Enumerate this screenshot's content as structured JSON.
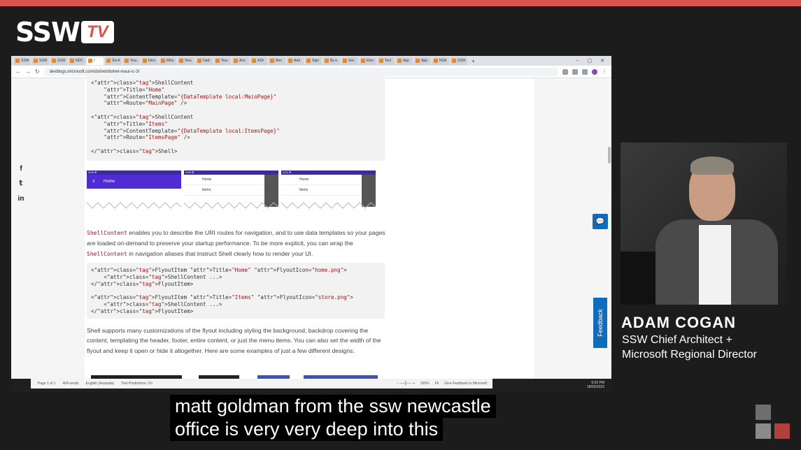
{
  "brand": {
    "logo_main": "SSW",
    "logo_tv": "TV",
    "accent": "#d9534f"
  },
  "browser": {
    "tabs": [
      "SSW",
      "SSW",
      "SSW",
      "NDC",
      "/",
      "Sis A",
      "Visu",
      "Intro",
      "Rthu",
      "Visu",
      "Upd:",
      "Visu",
      "Ann",
      "ASF",
      "Ann",
      "Add",
      "Sign",
      "By e",
      "Sec",
      "Elon",
      "Tesl",
      "App",
      "App",
      "NSA",
      "SSW"
    ],
    "active_tab_index": 4,
    "new_tab": "+",
    "url": "devblogs.microsoft.com/dotnet/dotnet-maui-rc-3/"
  },
  "social": {
    "facebook": "f",
    "twitter": "𝕥",
    "linkedin": "in"
  },
  "code1": {
    "lines": [
      "<ShellContent",
      "    Title=\"Home\"",
      "    ContentTemplate=\"{DataTemplate local:MainPage}\"",
      "    Route=\"MainPage\" />",
      "",
      "<ShellContent",
      "    Title=\"Items\"",
      "    ContentTemplate=\"{DataTemplate local:ItemsPage}\"",
      "    Route=\"ItemsPage\" />",
      "",
      "</Shell>"
    ]
  },
  "shots": {
    "phone1_status": "3:06 ⚙",
    "phone1_title": "Home",
    "phone2_status": "3:06 ⚙",
    "phone2_items": [
      "Home",
      "Items"
    ],
    "phone3_status": "3:21 ⚙",
    "phone3_items": [
      "Home",
      "Items"
    ]
  },
  "para1": {
    "kw1": "ShellContent",
    "text1": " enables you to describe the URI routes for navigation, and to use data templates so your pages are loaded on-demand to preserve your startup performance. To be more explicit, you can wrap the ",
    "kw2": "ShellContent",
    "text2": " in navigation aliases that instruct Shell clearly how to render your UI."
  },
  "code2": {
    "lines": [
      "<FlyoutItem Title=\"Home\" FlyoutIcon=\"home.png\">",
      "    <ShellContent ...>",
      "</FlyoutItem>",
      "",
      "<FlyoutItem Title=\"Items\" FlyoutIcon=\"store.png\">",
      "    <ShellContent ...>",
      "</FlyoutItem>"
    ]
  },
  "para2": "Shell supports many customizations of the flyout including styling the background, backdrop covering the content, templating the header, footer, entire content, or just the menu items. You can also set the width of the flyout and keep it open or hide it altogether. Here are some examples of just a few different designs:",
  "word_status": {
    "page": "Page 1 of 1",
    "words": "404 words",
    "language": "English (Australia)",
    "predictions": "Text Predictions: On",
    "zoom": "100%",
    "fit": "Fit",
    "feedback": "Give Feedback to Microsoft"
  },
  "clock": {
    "time": "6:52 PM",
    "date": "18/05/2022"
  },
  "feedback_tab": "Feedback",
  "presenter": {
    "name": "ADAM COGAN",
    "role_line1": "SSW Chief Architect +",
    "role_line2": "Microsoft Regional Director"
  },
  "caption": {
    "line1": "matt goldman from the ssw newcastle",
    "line2": "office is very very deep into this"
  },
  "corner_colors": [
    "#6e6e6e",
    "#8a8a8a",
    "#b0403c"
  ]
}
